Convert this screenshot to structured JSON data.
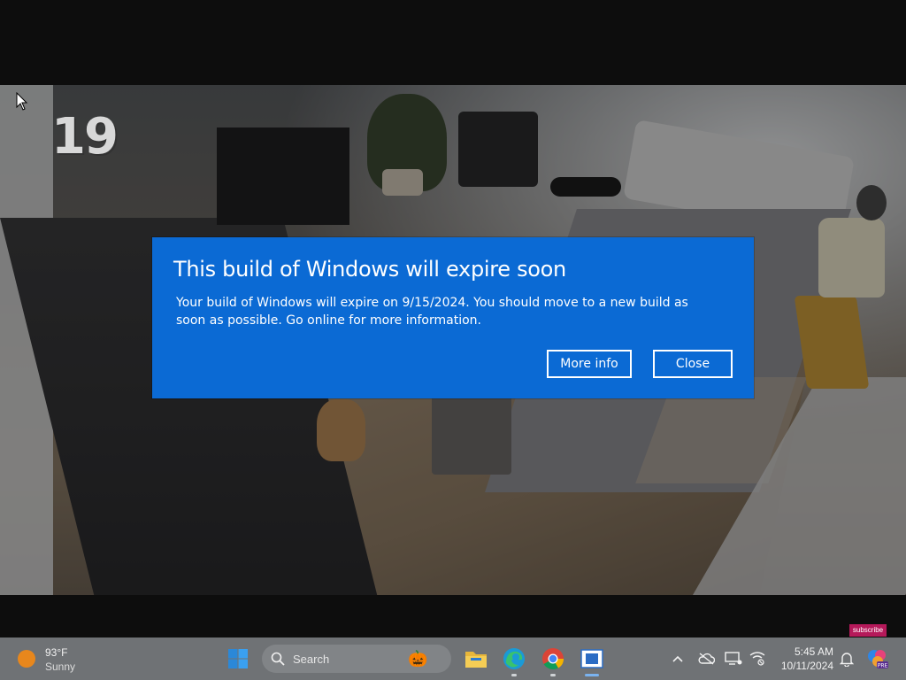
{
  "video": {
    "timestamp_overlay": "19",
    "subscribe_badge": "subscribe"
  },
  "dialog": {
    "title": "This build of Windows will expire soon",
    "message": "Your build of Windows will expire on 9/15/2024. You should move to a new build as soon as possible. Go online for more information.",
    "more_info_label": "More info",
    "close_label": "Close",
    "background_color": "#0b6ad4"
  },
  "taskbar": {
    "weather": {
      "temperature": "93°F",
      "condition": "Sunny",
      "icon": "sun-icon"
    },
    "search_placeholder": "Search",
    "apps": [
      {
        "name": "File Explorer",
        "icon": "folder-icon"
      },
      {
        "name": "Microsoft Edge",
        "icon": "edge-icon"
      },
      {
        "name": "Google Chrome",
        "icon": "chrome-icon"
      },
      {
        "name": "Active window",
        "icon": "window-icon"
      }
    ],
    "tray_icons": [
      "chevron-up-icon",
      "cloud-offline-icon",
      "display-icon",
      "network-icon",
      "notification-bell-icon",
      "copilot-icon"
    ],
    "clock": {
      "time": "5:45 AM",
      "date": "10/11/2024"
    },
    "copilot_badge": "PRE"
  }
}
